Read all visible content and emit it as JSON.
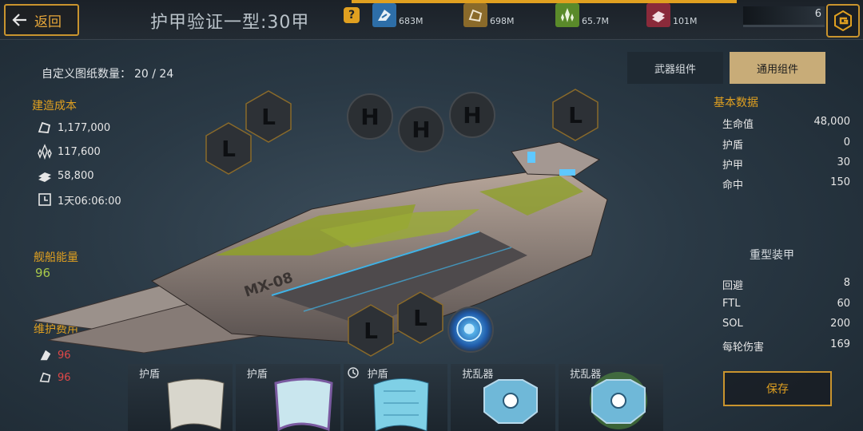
{
  "header": {
    "back_label": "返回",
    "title": "护甲验证一型:30甲",
    "help_label": "?",
    "energy_value": "6"
  },
  "resources": [
    {
      "icon": "metal-icon",
      "value": "683M",
      "color": "#2d6ea8"
    },
    {
      "icon": "crystal-ore-icon",
      "value": "698M",
      "color": "#8a6a2a"
    },
    {
      "icon": "deuterium-icon",
      "value": "65.7M",
      "color": "#5a8a2a"
    },
    {
      "icon": "alloy-icon",
      "value": "101M",
      "color": "#8a2a3a"
    }
  ],
  "left": {
    "blueprint_label": "自定义图纸数量：",
    "blueprint_value": "20 / 24",
    "build_cost_label": "建造成本",
    "costs": [
      {
        "icon": "ore-icon",
        "value": "1,177,000"
      },
      {
        "icon": "crystal-icon",
        "value": "117,600"
      },
      {
        "icon": "alloy-icon",
        "value": "58,800"
      },
      {
        "icon": "clock-icon",
        "value": "1天06:06:00"
      }
    ],
    "energy_label": "舰船能量",
    "energy_value": "96",
    "maintenance_label": "维护费用",
    "maintenance": [
      {
        "icon": "metal-icon",
        "value": "96"
      },
      {
        "icon": "ore-icon",
        "value": "96"
      }
    ]
  },
  "tabs": {
    "weapon": "武器组件",
    "general": "通用组件",
    "active": "general"
  },
  "stats": {
    "title": "基本数据",
    "rows": [
      {
        "label": "生命值",
        "value": "48,000"
      },
      {
        "label": "护盾",
        "value": "0"
      },
      {
        "label": "护甲",
        "value": "30"
      },
      {
        "label": "命中",
        "value": "150"
      }
    ],
    "armor_type": "重型装甲",
    "rows2": [
      {
        "label": "回避",
        "value": "8"
      },
      {
        "label": "FTL",
        "value": "60"
      },
      {
        "label": "SOL",
        "value": "200"
      },
      {
        "label": "每轮伤害",
        "value": "169"
      }
    ],
    "save_label": "保存"
  },
  "slots": {
    "l": "L",
    "h": "H",
    "ship_label": "MX-08"
  },
  "tray": [
    {
      "label": "护盾",
      "art": "shield-plate-silver"
    },
    {
      "label": "护盾",
      "art": "shield-plate-purple"
    },
    {
      "label": "护盾",
      "art": "shield-plate-hex"
    },
    {
      "label": "扰乱器",
      "art": "jammer-blue"
    },
    {
      "label": "扰乱器",
      "art": "jammer-green"
    }
  ]
}
